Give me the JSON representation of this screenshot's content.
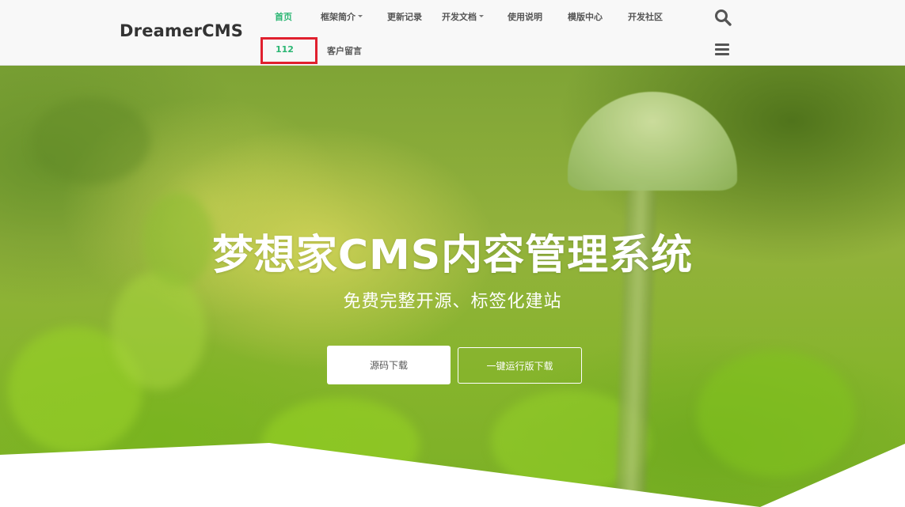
{
  "header": {
    "logo": "DreamerCMS",
    "nav": {
      "home": "首页",
      "framework": "框架简介",
      "changelog": "更新记录",
      "dev_docs": "开发文档",
      "usage": "使用说明",
      "templates": "模版中心",
      "community": "开发社区",
      "item_112": "112",
      "guestbook": "客户留言"
    },
    "active_color": "#2bb673"
  },
  "hero": {
    "title": "梦想家CMS内容管理系统",
    "subtitle": "免费完整开源、标签化建站",
    "btn_source": "源码下载",
    "btn_run": "一键运行版下载"
  },
  "icons": {
    "search": "search-icon",
    "menu": "hamburger-menu-icon"
  },
  "highlight_color": "#e0202e"
}
